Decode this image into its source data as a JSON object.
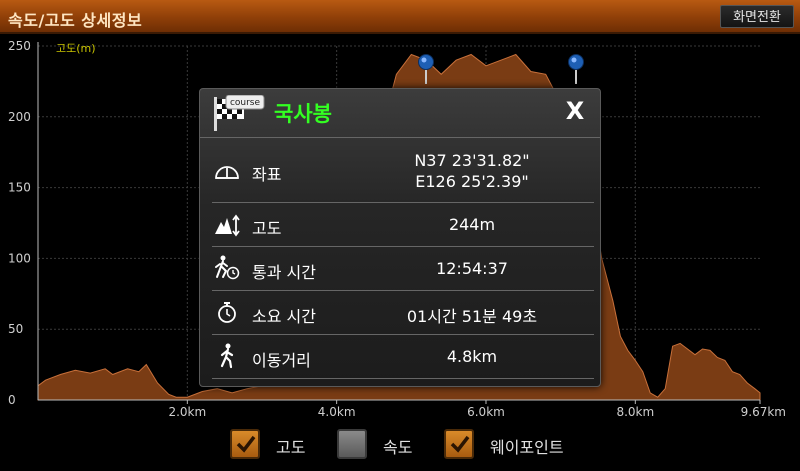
{
  "header": {
    "title": "속도/고도 상세정보",
    "switch_label": "화면전환"
  },
  "chart_data": {
    "type": "area",
    "ylabel": "고도(m)",
    "ylim": [
      0,
      250
    ],
    "y_ticks": [
      "0",
      "50",
      "100",
      "150",
      "200",
      "250"
    ],
    "x_ticks": [
      {
        "v": 2.0,
        "label": "2.0km"
      },
      {
        "v": 4.0,
        "label": "4.0km"
      },
      {
        "v": 6.0,
        "label": "6.0km"
      },
      {
        "v": 8.0,
        "label": "8.0km"
      },
      {
        "v": 9.67,
        "label": "9.67km"
      }
    ],
    "xlim": [
      0,
      9.67
    ],
    "grid": true,
    "fill_color": "#7a3c14",
    "series": [
      {
        "x": [
          0,
          0.1,
          0.3,
          0.5,
          0.7,
          0.9,
          1.0,
          1.2,
          1.35,
          1.45,
          1.6,
          1.75,
          1.85,
          2.0,
          2.2,
          2.4,
          2.6,
          2.8,
          3.0,
          3.2,
          3.4,
          3.6,
          3.8,
          4.0,
          4.2,
          4.4,
          4.6,
          4.8,
          5.0,
          5.2,
          5.4,
          5.6,
          5.8,
          6.0,
          6.2,
          6.4,
          6.6,
          6.8,
          7.0,
          7.2,
          7.4,
          7.55,
          7.7,
          7.8,
          7.9,
          8.0,
          8.1,
          8.2,
          8.3,
          8.4,
          8.5,
          8.6,
          8.8,
          8.9,
          9.0,
          9.1,
          9.2,
          9.3,
          9.4,
          9.5,
          9.6,
          9.67
        ],
        "y": [
          10,
          14,
          18,
          21,
          19,
          22,
          18,
          22,
          20,
          25,
          12,
          4,
          2,
          2,
          6,
          8,
          5,
          8,
          10,
          14,
          20,
          30,
          50,
          80,
          120,
          150,
          190,
          230,
          244,
          240,
          230,
          240,
          244,
          236,
          240,
          244,
          232,
          230,
          210,
          190,
          150,
          100,
          70,
          45,
          35,
          28,
          20,
          5,
          2,
          8,
          38,
          40,
          32,
          36,
          35,
          30,
          28,
          20,
          18,
          12,
          8,
          5
        ]
      }
    ],
    "waypoints": [
      5.2,
      7.2
    ]
  },
  "popup": {
    "title": "국사봉",
    "flag_badge": "course",
    "close_label": "X",
    "rows": [
      {
        "label": "좌표",
        "value": "N37 23'31.82\"",
        "value2": "E126 25'2.39\"",
        "icon": "compass-icon"
      },
      {
        "label": "고도",
        "value": "244m",
        "icon": "altitude-icon"
      },
      {
        "label": "통과 시간",
        "value": "12:54:37",
        "icon": "walk-clock-icon"
      },
      {
        "label": "소요 시간",
        "value": "01시간 51분 49초",
        "icon": "stopwatch-icon"
      },
      {
        "label": "이동거리",
        "value": "4.8km",
        "icon": "walker-icon"
      }
    ]
  },
  "legend": {
    "items": [
      {
        "label": "고도",
        "checked": true
      },
      {
        "label": "속도",
        "checked": false
      },
      {
        "label": "웨이포인트",
        "checked": true
      }
    ]
  }
}
